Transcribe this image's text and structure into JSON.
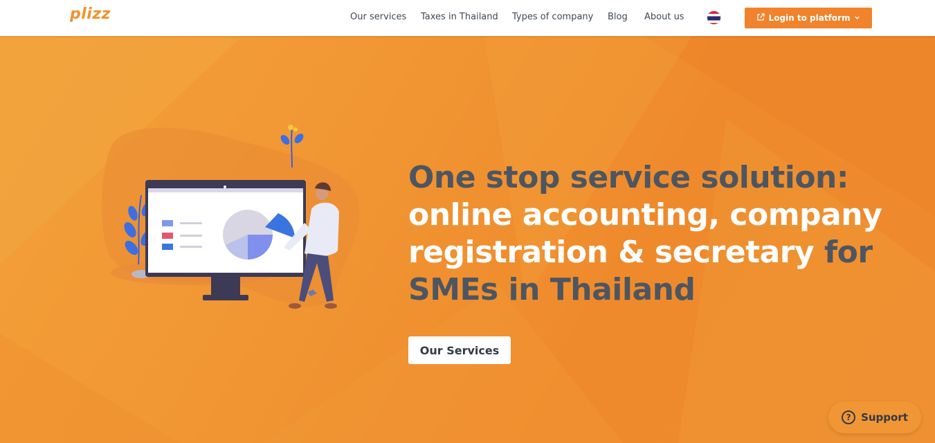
{
  "brand": {
    "logo_text": "plizz",
    "accent": "#f0922e"
  },
  "nav": {
    "items": [
      {
        "label": "Our services"
      },
      {
        "label": "Taxes in Thailand"
      },
      {
        "label": "Types of company"
      },
      {
        "label": "Blog"
      },
      {
        "label": "About us"
      }
    ],
    "language_icon": "thailand-flag-icon",
    "login_label": "Login to platform",
    "login_icon": "external-link-icon",
    "login_caret_icon": "chevron-down-icon"
  },
  "hero": {
    "headline_dark_1": "One stop service solution: ",
    "headline_light": "online accounting, company registration & secretary",
    "headline_dark_2": " for SMEs in Thailand",
    "cta_label": "Our Services",
    "illustration": "person-with-monitor-pie-chart-illustration"
  },
  "support": {
    "label": "Support",
    "icon": "question-circle-icon"
  },
  "colors": {
    "dark_text": "#4d5660",
    "white": "#ffffff",
    "button_orange": "#f0832c"
  }
}
